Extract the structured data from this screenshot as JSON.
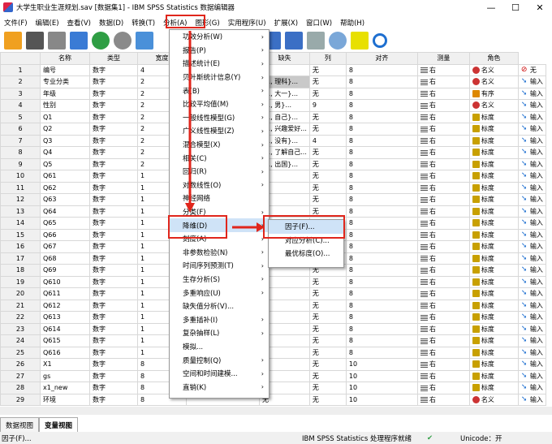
{
  "window": {
    "title": "大学生职业生涯规划.sav [数据集1] - IBM SPSS Statistics 数据编辑器"
  },
  "menubar": [
    "文件(F)",
    "编辑(E)",
    "查看(V)",
    "数据(D)",
    "转换(T)",
    "分析(A)",
    "图形(G)",
    "实用程序(U)",
    "扩展(X)",
    "窗口(W)",
    "帮助(H)"
  ],
  "columns": [
    "名称",
    "类型",
    "宽度",
    "值",
    "缺失",
    "列",
    "对齐",
    "测量",
    "角色"
  ],
  "rows": [
    {
      "n": "1",
      "name": "编号",
      "type": "数字",
      "w": "4",
      "val": "无",
      "miss": "无",
      "col": "8",
      "align": "右",
      "meas": "名义",
      "role": "无"
    },
    {
      "n": "2",
      "name": "专业分类",
      "type": "数字",
      "w": "2",
      "val": "{1, 理科}...",
      "miss": "无",
      "col": "8",
      "align": "右",
      "meas": "名义",
      "role": "输入"
    },
    {
      "n": "3",
      "name": "年级",
      "type": "数字",
      "w": "2",
      "val": "{1, 大一}...",
      "miss": "无",
      "col": "8",
      "align": "右",
      "meas": "有序",
      "role": "输入"
    },
    {
      "n": "4",
      "name": "性别",
      "type": "数字",
      "w": "2",
      "val": "{1, 男}...",
      "miss": "9",
      "col": "8",
      "align": "右",
      "meas": "名义",
      "role": "输入"
    },
    {
      "n": "5",
      "name": "Q1",
      "type": "数字",
      "w": "2",
      "val": "{1, 自己}...",
      "miss": "无",
      "col": "8",
      "align": "右",
      "meas": "标度",
      "role": "输入"
    },
    {
      "n": "6",
      "name": "Q2",
      "type": "数字",
      "w": "2",
      "val": "{1, 兴趣爱好...",
      "miss": "无",
      "col": "8",
      "align": "右",
      "meas": "标度",
      "role": "输入"
    },
    {
      "n": "7",
      "name": "Q3",
      "type": "数字",
      "w": "2",
      "val": "{1, 没有}...",
      "miss": "4",
      "col": "8",
      "align": "右",
      "meas": "标度",
      "role": "输入"
    },
    {
      "n": "8",
      "name": "Q4",
      "type": "数字",
      "w": "2",
      "val": "{1, 了解自己...",
      "miss": "无",
      "col": "8",
      "align": "右",
      "meas": "标度",
      "role": "输入"
    },
    {
      "n": "9",
      "name": "Q5",
      "type": "数字",
      "w": "2",
      "val": "{1, 出国}...",
      "miss": "无",
      "col": "8",
      "align": "右",
      "meas": "标度",
      "role": "输入"
    },
    {
      "n": "10",
      "name": "Q61",
      "type": "数字",
      "w": "1",
      "val": "无",
      "miss": "无",
      "col": "8",
      "align": "右",
      "meas": "标度",
      "role": "输入"
    },
    {
      "n": "11",
      "name": "Q62",
      "type": "数字",
      "w": "1",
      "val": "无",
      "miss": "无",
      "col": "8",
      "align": "右",
      "meas": "标度",
      "role": "输入"
    },
    {
      "n": "12",
      "name": "Q63",
      "type": "数字",
      "w": "1",
      "val": "无",
      "miss": "无",
      "col": "8",
      "align": "右",
      "meas": "标度",
      "role": "输入"
    },
    {
      "n": "13",
      "name": "Q64",
      "type": "数字",
      "w": "1",
      "val": "无",
      "miss": "无",
      "col": "8",
      "align": "右",
      "meas": "标度",
      "role": "输入"
    },
    {
      "n": "14",
      "name": "Q65",
      "type": "数字",
      "w": "1",
      "val": "无",
      "miss": "无",
      "col": "8",
      "align": "右",
      "meas": "标度",
      "role": "输入"
    },
    {
      "n": "15",
      "name": "Q66",
      "type": "数字",
      "w": "1",
      "val": "无",
      "miss": "无",
      "col": "8",
      "align": "右",
      "meas": "标度",
      "role": "输入"
    },
    {
      "n": "16",
      "name": "Q67",
      "type": "数字",
      "w": "1",
      "val": "无",
      "miss": "无",
      "col": "8",
      "align": "右",
      "meas": "标度",
      "role": "输入"
    },
    {
      "n": "17",
      "name": "Q68",
      "type": "数字",
      "w": "1",
      "val": "无",
      "miss": "无",
      "col": "8",
      "align": "右",
      "meas": "标度",
      "role": "输入"
    },
    {
      "n": "18",
      "name": "Q69",
      "type": "数字",
      "w": "1",
      "val": "无",
      "miss": "无",
      "col": "8",
      "align": "右",
      "meas": "标度",
      "role": "输入"
    },
    {
      "n": "19",
      "name": "Q610",
      "type": "数字",
      "w": "1",
      "val": "无",
      "miss": "无",
      "col": "8",
      "align": "右",
      "meas": "标度",
      "role": "输入"
    },
    {
      "n": "20",
      "name": "Q611",
      "type": "数字",
      "w": "1",
      "val": "无",
      "miss": "无",
      "col": "8",
      "align": "右",
      "meas": "标度",
      "role": "输入"
    },
    {
      "n": "21",
      "name": "Q612",
      "type": "数字",
      "w": "1",
      "val": "无",
      "miss": "无",
      "col": "8",
      "align": "右",
      "meas": "标度",
      "role": "输入"
    },
    {
      "n": "22",
      "name": "Q613",
      "type": "数字",
      "w": "1",
      "val": "无",
      "miss": "无",
      "col": "8",
      "align": "右",
      "meas": "标度",
      "role": "输入"
    },
    {
      "n": "23",
      "name": "Q614",
      "type": "数字",
      "w": "1",
      "val": "无",
      "miss": "无",
      "col": "8",
      "align": "右",
      "meas": "标度",
      "role": "输入"
    },
    {
      "n": "24",
      "name": "Q615",
      "type": "数字",
      "w": "1",
      "val": "无",
      "miss": "无",
      "col": "8",
      "align": "右",
      "meas": "标度",
      "role": "输入"
    },
    {
      "n": "25",
      "name": "Q616",
      "type": "数字",
      "w": "1",
      "val": "无",
      "miss": "无",
      "col": "8",
      "align": "右",
      "meas": "标度",
      "role": "输入"
    },
    {
      "n": "26",
      "name": "X1",
      "type": "数字",
      "w": "8",
      "val": "无",
      "miss": "无",
      "col": "10",
      "align": "右",
      "meas": "标度",
      "role": "输入"
    },
    {
      "n": "27",
      "name": "gs",
      "type": "数字",
      "w": "8",
      "val": "无",
      "miss": "无",
      "col": "10",
      "align": "右",
      "meas": "标度",
      "role": "输入"
    },
    {
      "n": "28",
      "name": "x1_new",
      "type": "数字",
      "w": "8",
      "val": "无",
      "miss": "无",
      "col": "10",
      "align": "右",
      "meas": "标度",
      "role": "输入"
    },
    {
      "n": "29",
      "name": "环境",
      "type": "数字",
      "w": "8",
      "val": "无",
      "miss": "无",
      "col": "10",
      "align": "右",
      "meas": "名义",
      "role": "输入"
    }
  ],
  "analyze_menu": [
    "功效分析(W)",
    "报告(P)",
    "描述统计(E)",
    "贝叶斯统计信息(Y)",
    "表(B)",
    "比较平均值(M)",
    "一般线性模型(G)",
    "广义线性模型(Z)",
    "混合模型(X)",
    "相关(C)",
    "回归(R)",
    "对数线性(O)",
    "神经网络",
    "分类(F)",
    "降维(D)",
    "刻度(A)",
    "非参数检验(N)",
    "时间序列预测(T)",
    "生存分析(S)",
    "多重响应(U)",
    "缺失值分析(V)...",
    "多重插补(I)",
    "复杂抽样(L)",
    "模拟...",
    "质量控制(Q)",
    "空间和时间建模...",
    "直销(K)"
  ],
  "submenu": [
    "因子(F)...",
    "对应分析(C)...",
    "最优标度(O)..."
  ],
  "tabs": [
    "数据视图",
    "变量视图"
  ],
  "status": {
    "left": "因子(F)...",
    "center": "IBM SPSS Statistics 处理程序就绪",
    "unicode": "Unicode：开"
  }
}
